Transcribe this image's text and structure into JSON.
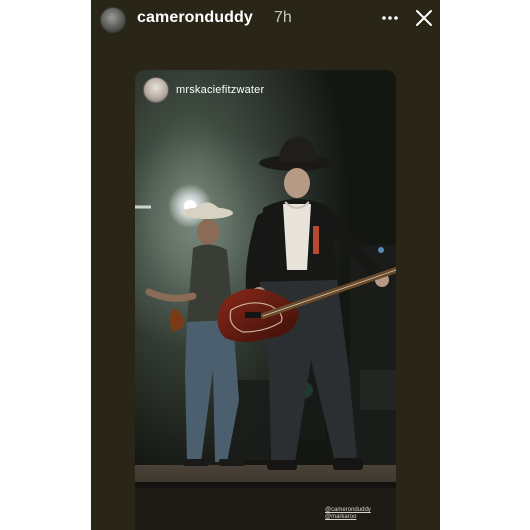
{
  "story": {
    "username": "cameronduddy",
    "time_ago": "7h",
    "more_icon": "more-horizontal-icon",
    "close_icon": "close-icon"
  },
  "shared_post": {
    "username": "mrskaciefitzwater",
    "mentions": [
      "@cameronduddy",
      "@markaroo"
    ]
  },
  "colors": {
    "story_background": "#292517",
    "page_background": "#ffffff",
    "text_primary": "#ffffff"
  }
}
